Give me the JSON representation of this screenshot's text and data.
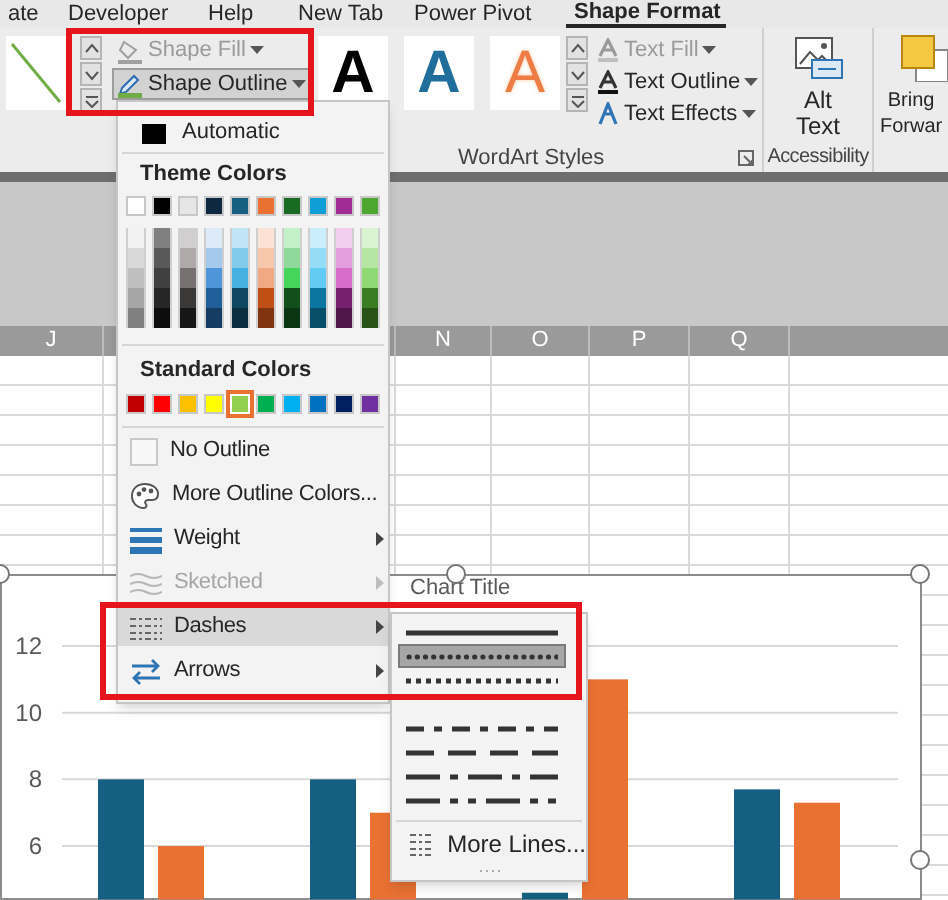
{
  "ribbon_tabs": [
    {
      "label": "ate",
      "selected": false
    },
    {
      "label": "Developer",
      "selected": false
    },
    {
      "label": "Help",
      "selected": false
    },
    {
      "label": "New Tab",
      "selected": false
    },
    {
      "label": "Power Pivot",
      "selected": false
    },
    {
      "label": "Shape Format",
      "selected": true
    }
  ],
  "shape_styles": {
    "buttons": [
      {
        "label": "Shape Fill",
        "kind": "fill",
        "disabled": true,
        "pressed": false
      },
      {
        "label": "Shape Outline",
        "kind": "outline",
        "disabled": false,
        "pressed": true
      }
    ]
  },
  "wordart_styles": {
    "label": "WordArt Styles",
    "styles": [
      {
        "letter": "A",
        "kind": "fill",
        "color": "#000000"
      },
      {
        "letter": "A",
        "kind": "fill",
        "color": "#1f6e9c"
      },
      {
        "letter": "A",
        "kind": "outline",
        "color": "#ed7d45"
      }
    ],
    "buttons": [
      {
        "label": "Text Fill",
        "kind": "fill",
        "disabled": true
      },
      {
        "label": "Text Outline",
        "kind": "outline",
        "disabled": false
      },
      {
        "label": "Text Effects",
        "kind": "effects",
        "disabled": false
      }
    ]
  },
  "accessibility": {
    "label": "Accessibility",
    "button_lines": [
      "Alt",
      "Text"
    ]
  },
  "arrange": {
    "button_lines": [
      "Bring",
      "Forwar"
    ]
  },
  "sheet": {
    "columns": [
      "J",
      "N",
      "O",
      "P",
      "Q"
    ]
  },
  "chart": {
    "title": "Chart Title",
    "chart_data": {
      "type": "bar",
      "ylim": [
        4.4,
        12
      ],
      "yticks": [
        6,
        8,
        10,
        12
      ],
      "grid": true,
      "series": [
        {
          "color": "#156082",
          "values": [
            8,
            8,
            4.6,
            7.7
          ]
        },
        {
          "color": "#e97132",
          "values": [
            6,
            7,
            11,
            7.3
          ]
        }
      ]
    }
  },
  "outline_menu": {
    "automatic": {
      "label": "Automatic"
    },
    "theme_colors": {
      "label": "Theme Colors",
      "colors": [
        {
          "color": "#ffffff",
          "selected": false,
          "shades": [
            {
              "color": "#f2f2f2"
            },
            {
              "color": "#d9d9d9"
            },
            {
              "color": "#bfbfbf"
            },
            {
              "color": "#a6a6a6"
            },
            {
              "color": "#808080"
            }
          ]
        },
        {
          "color": "#000000",
          "selected": false,
          "shades": [
            {
              "color": "#808080"
            },
            {
              "color": "#595959"
            },
            {
              "color": "#404040"
            },
            {
              "color": "#262626"
            },
            {
              "color": "#0d0d0d"
            }
          ]
        },
        {
          "color": "#e7e6e6",
          "selected": false,
          "shades": [
            {
              "color": "#d0cece"
            },
            {
              "color": "#aeaaaa"
            },
            {
              "color": "#757171"
            },
            {
              "color": "#3b3838"
            },
            {
              "color": "#171616"
            }
          ]
        },
        {
          "color": "#0e2841",
          "selected": false,
          "shades": [
            {
              "color": "#dceaf7"
            },
            {
              "color": "#a5c8ed"
            },
            {
              "color": "#4e95d9"
            },
            {
              "color": "#215f9a"
            },
            {
              "color": "#153d64"
            }
          ]
        },
        {
          "color": "#156082",
          "selected": false,
          "shades": [
            {
              "color": "#c1e5f5"
            },
            {
              "color": "#83cbeb"
            },
            {
              "color": "#45b0e1"
            },
            {
              "color": "#0f4761"
            },
            {
              "color": "#0a2f40"
            }
          ]
        },
        {
          "color": "#e97132",
          "selected": false,
          "shades": [
            {
              "color": "#fbe2d5"
            },
            {
              "color": "#f7c7ac"
            },
            {
              "color": "#f1a983"
            },
            {
              "color": "#c04f15"
            },
            {
              "color": "#803510"
            }
          ]
        },
        {
          "color": "#196b24",
          "selected": false,
          "shades": [
            {
              "color": "#c2f1c8"
            },
            {
              "color": "#8ed99b"
            },
            {
              "color": "#47d45a"
            },
            {
              "color": "#124f1a"
            },
            {
              "color": "#0c3511"
            }
          ]
        },
        {
          "color": "#0f9ed5",
          "selected": false,
          "shades": [
            {
              "color": "#caeefb"
            },
            {
              "color": "#95dcf7"
            },
            {
              "color": "#61cbf3"
            },
            {
              "color": "#0b76a0"
            },
            {
              "color": "#074f69"
            }
          ]
        },
        {
          "color": "#a02b93",
          "selected": false,
          "shades": [
            {
              "color": "#f2cfee"
            },
            {
              "color": "#e59edd"
            },
            {
              "color": "#d86dcb"
            },
            {
              "color": "#782070"
            },
            {
              "color": "#501549"
            }
          ]
        },
        {
          "color": "#4ea72e",
          "selected": false,
          "shades": [
            {
              "color": "#d9f2d0"
            },
            {
              "color": "#b4e5a2"
            },
            {
              "color": "#8ed973"
            },
            {
              "color": "#3b7d23"
            },
            {
              "color": "#275317"
            }
          ]
        }
      ]
    },
    "standard_colors": {
      "label": "Standard Colors",
      "colors": [
        {
          "color": "#c00000",
          "selected": false
        },
        {
          "color": "#ff0000",
          "selected": false
        },
        {
          "color": "#ffc000",
          "selected": false
        },
        {
          "color": "#ffff00",
          "selected": false
        },
        {
          "color": "#92d050",
          "selected": true
        },
        {
          "color": "#00b050",
          "selected": false
        },
        {
          "color": "#00b0f0",
          "selected": false
        },
        {
          "color": "#0070c0",
          "selected": false
        },
        {
          "color": "#002060",
          "selected": false
        },
        {
          "color": "#7030a0",
          "selected": false
        }
      ]
    },
    "items": [
      {
        "kind": "no_outline",
        "label": "No Outline",
        "disabled": false,
        "highlighted": false,
        "submenu": false
      },
      {
        "kind": "more_colors",
        "label": "More Outline Colors...",
        "disabled": false,
        "highlighted": false,
        "submenu": false
      },
      {
        "kind": "weight",
        "label": "Weight",
        "disabled": false,
        "highlighted": false,
        "submenu": true
      },
      {
        "kind": "sketched",
        "label": "Sketched",
        "disabled": true,
        "highlighted": false,
        "submenu": true
      },
      {
        "kind": "dashes",
        "label": "Dashes",
        "disabled": false,
        "highlighted": true,
        "submenu": true
      },
      {
        "kind": "arrows",
        "label": "Arrows",
        "disabled": false,
        "highlighted": false,
        "submenu": true
      }
    ]
  },
  "dashes_menu": {
    "styles": [
      {
        "kind": "solid",
        "selected": false
      },
      {
        "kind": "round_dot",
        "selected": true
      },
      {
        "kind": "square_dot",
        "selected": false
      },
      {
        "kind": "dash_dot",
        "selected": false
      },
      {
        "kind": "dash",
        "selected": false
      },
      {
        "kind": "long_dash_dot",
        "selected": false
      },
      {
        "kind": "long_dash_dot_dot",
        "selected": false
      }
    ],
    "more": {
      "label": "More Lines..."
    }
  }
}
